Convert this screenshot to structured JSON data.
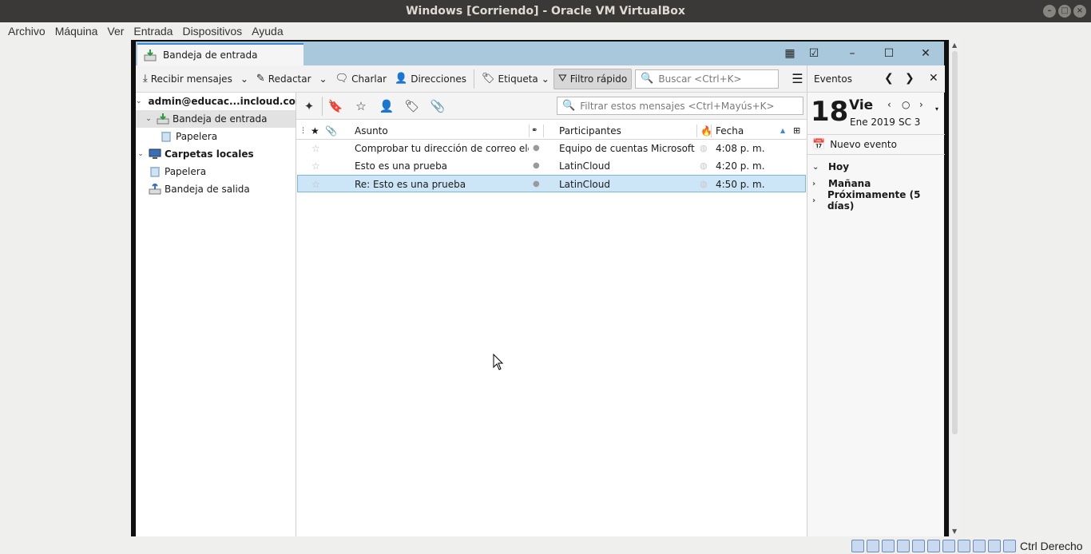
{
  "host": {
    "title": "Windows [Corriendo] - Oracle VM VirtualBox",
    "menu": [
      "Archivo",
      "Máquina",
      "Ver",
      "Entrada",
      "Dispositivos",
      "Ayuda"
    ],
    "status_right": "Ctrl Derecho"
  },
  "tab": {
    "label": "Bandeja de entrada"
  },
  "toolbar": {
    "get_messages": "Recibir mensajes",
    "write": "Redactar",
    "chat": "Charlar",
    "address_book": "Direcciones",
    "tag": "Etiqueta",
    "quick_filter": "Filtro rápido",
    "search_placeholder": "Buscar <Ctrl+K>"
  },
  "folders": {
    "account": "admin@educac...incloud.com",
    "inbox": "Bandeja de entrada",
    "trash": "Papelera",
    "local": "Carpetas locales",
    "local_trash": "Papelera",
    "outbox": "Bandeja de salida"
  },
  "quickfilter": {
    "placeholder": "Filtrar estos mensajes <Ctrl+Mayús+K>"
  },
  "columns": {
    "subject": "Asunto",
    "participants": "Participantes",
    "date": "Fecha"
  },
  "messages": [
    {
      "subject": "Comprobar tu dirección de correo elect...",
      "participants": "Equipo de cuentas Microsoft",
      "date": "4:08 p. m."
    },
    {
      "subject": "Esto es una prueba",
      "participants": "LatinCloud",
      "date": "4:20 p. m."
    },
    {
      "subject": "Re: Esto es una prueba",
      "participants": "LatinCloud",
      "date": "4:50 p. m."
    }
  ],
  "events": {
    "title": "Eventos",
    "day_number": "18",
    "day_name": "Vie",
    "month_year": "Ene 2019",
    "week": "SC 3",
    "new_event": "Nuevo evento",
    "groups": [
      "Hoy",
      "Mañana",
      "Próximamente (5 días)"
    ]
  },
  "colors": {
    "tabstrip": "#a9c8dc",
    "selection": "#cde6f7",
    "titlebar": "#3a3937"
  }
}
